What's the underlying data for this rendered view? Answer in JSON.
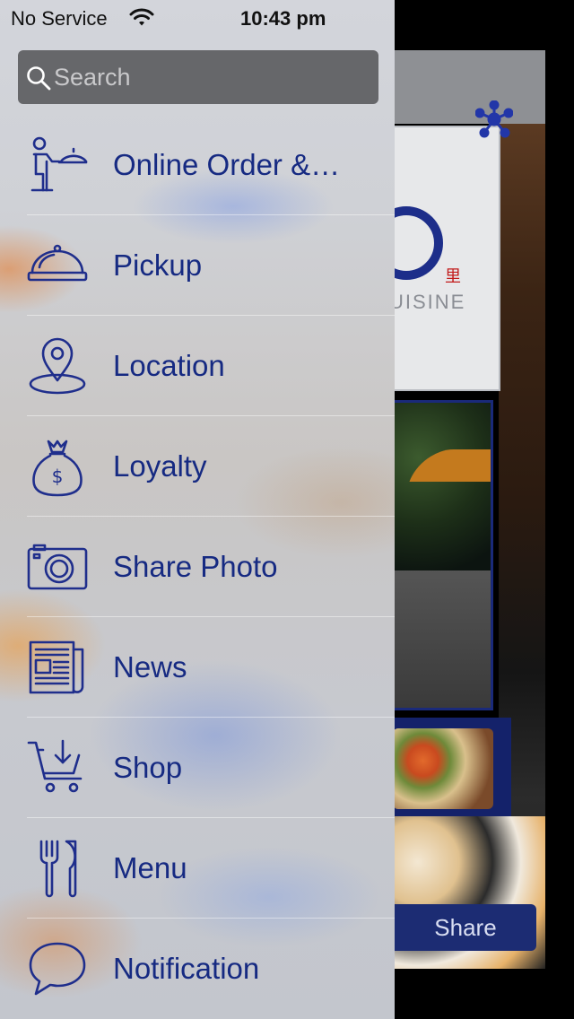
{
  "status_bar": {
    "carrier": "No Service",
    "time": "10:43 pm"
  },
  "search": {
    "placeholder": "Search",
    "value": ""
  },
  "menu": {
    "items": [
      {
        "label": "Online Order &…",
        "icon": "waiter-tray-icon"
      },
      {
        "label": "Pickup",
        "icon": "cloche-icon"
      },
      {
        "label": "Location",
        "icon": "map-pin-icon"
      },
      {
        "label": "Loyalty",
        "icon": "money-bag-icon"
      },
      {
        "label": "Share Photo",
        "icon": "camera-icon"
      },
      {
        "label": "News",
        "icon": "newspaper-icon"
      },
      {
        "label": "Shop",
        "icon": "shopping-cart-icon"
      },
      {
        "label": "Menu",
        "icon": "fork-knife-icon"
      },
      {
        "label": "Notification",
        "icon": "speech-bubble-icon"
      }
    ]
  },
  "background": {
    "logo_char": "里",
    "logo_text": "UISINE",
    "share_label": "Share"
  },
  "colors": {
    "menu_text": "#162a82",
    "icon_stroke": "#1f2e8c",
    "search_bg": "#66676a",
    "share_button": "#1c2c73"
  }
}
